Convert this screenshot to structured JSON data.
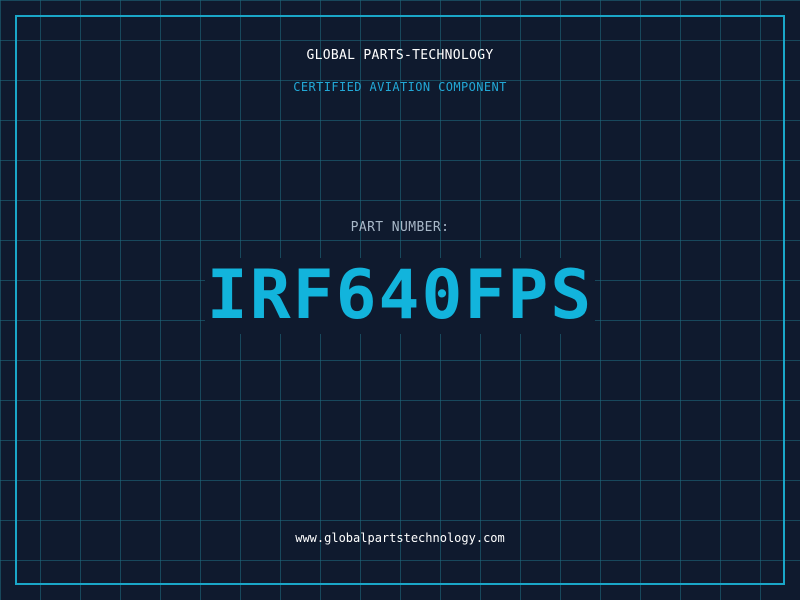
{
  "header": {
    "company": "GLOBAL PARTS-TECHNOLOGY",
    "subtitle": "CERTIFIED AVIATION COMPONENT"
  },
  "part": {
    "label": "PART NUMBER:",
    "number": "IRF640FPS"
  },
  "footer": {
    "url": "www.globalpartstechnology.com"
  },
  "colors": {
    "background": "#0f1a2e",
    "grid": "#1e6e82",
    "frame": "#1aa6c8",
    "accent": "#12b4dc"
  }
}
